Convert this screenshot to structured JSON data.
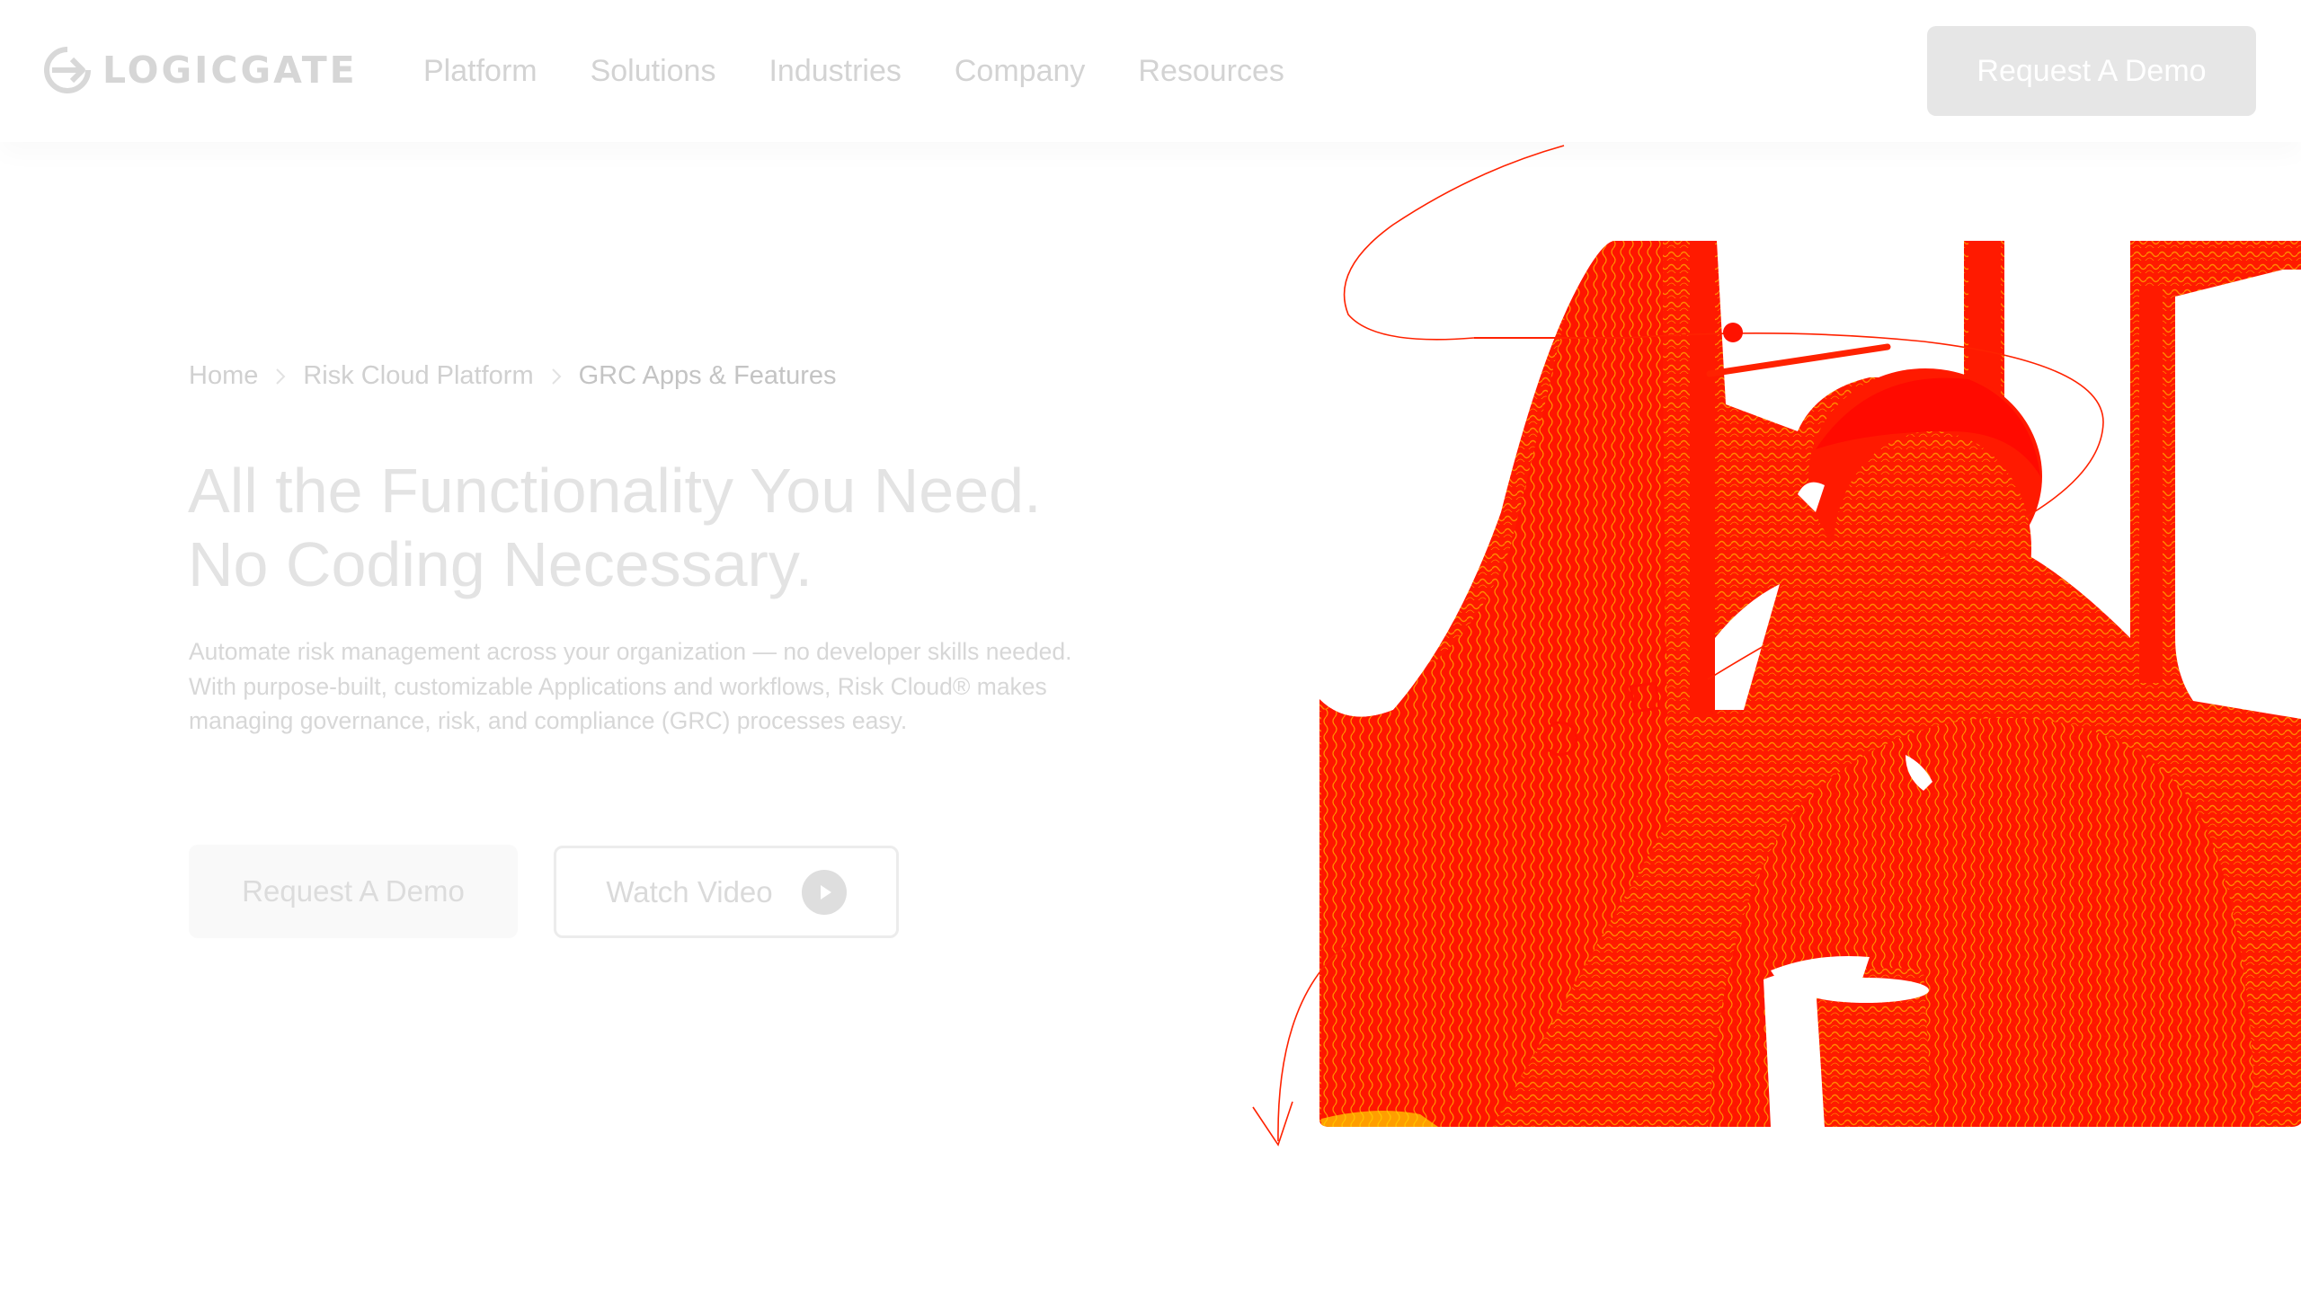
{
  "header": {
    "logo_text": "LOGICGATE",
    "nav": [
      "Platform",
      "Solutions",
      "Industries",
      "Company",
      "Resources"
    ],
    "cta_label": "Request A Demo"
  },
  "breadcrumb": [
    "Home",
    "Risk Cloud Platform",
    "GRC Apps & Features"
  ],
  "hero": {
    "title_line1": "All the Functionality You Need.",
    "title_line2": "No Coding Necessary.",
    "description_line1": "Automate risk management across your organization — no developer skills needed.",
    "description_line2": "With purpose-built, customizable Applications and workflows, Risk Cloud® makes",
    "description_line3": "managing governance, risk, and compliance (GRC) processes easy.",
    "primary_cta": "Request A Demo",
    "secondary_cta": "Watch Video"
  },
  "icons": {
    "logo": "logicgate-logo-icon",
    "breadcrumb_separator": "chevron-right-icon",
    "video": "play-icon",
    "illustration_arrow": "arrow-down-icon"
  },
  "colors": {
    "image_red": "#ff1a00",
    "image_orange": "#ff8a00",
    "muted_text": "#d3d3d3",
    "cta_gray": "#e6e6e6"
  }
}
